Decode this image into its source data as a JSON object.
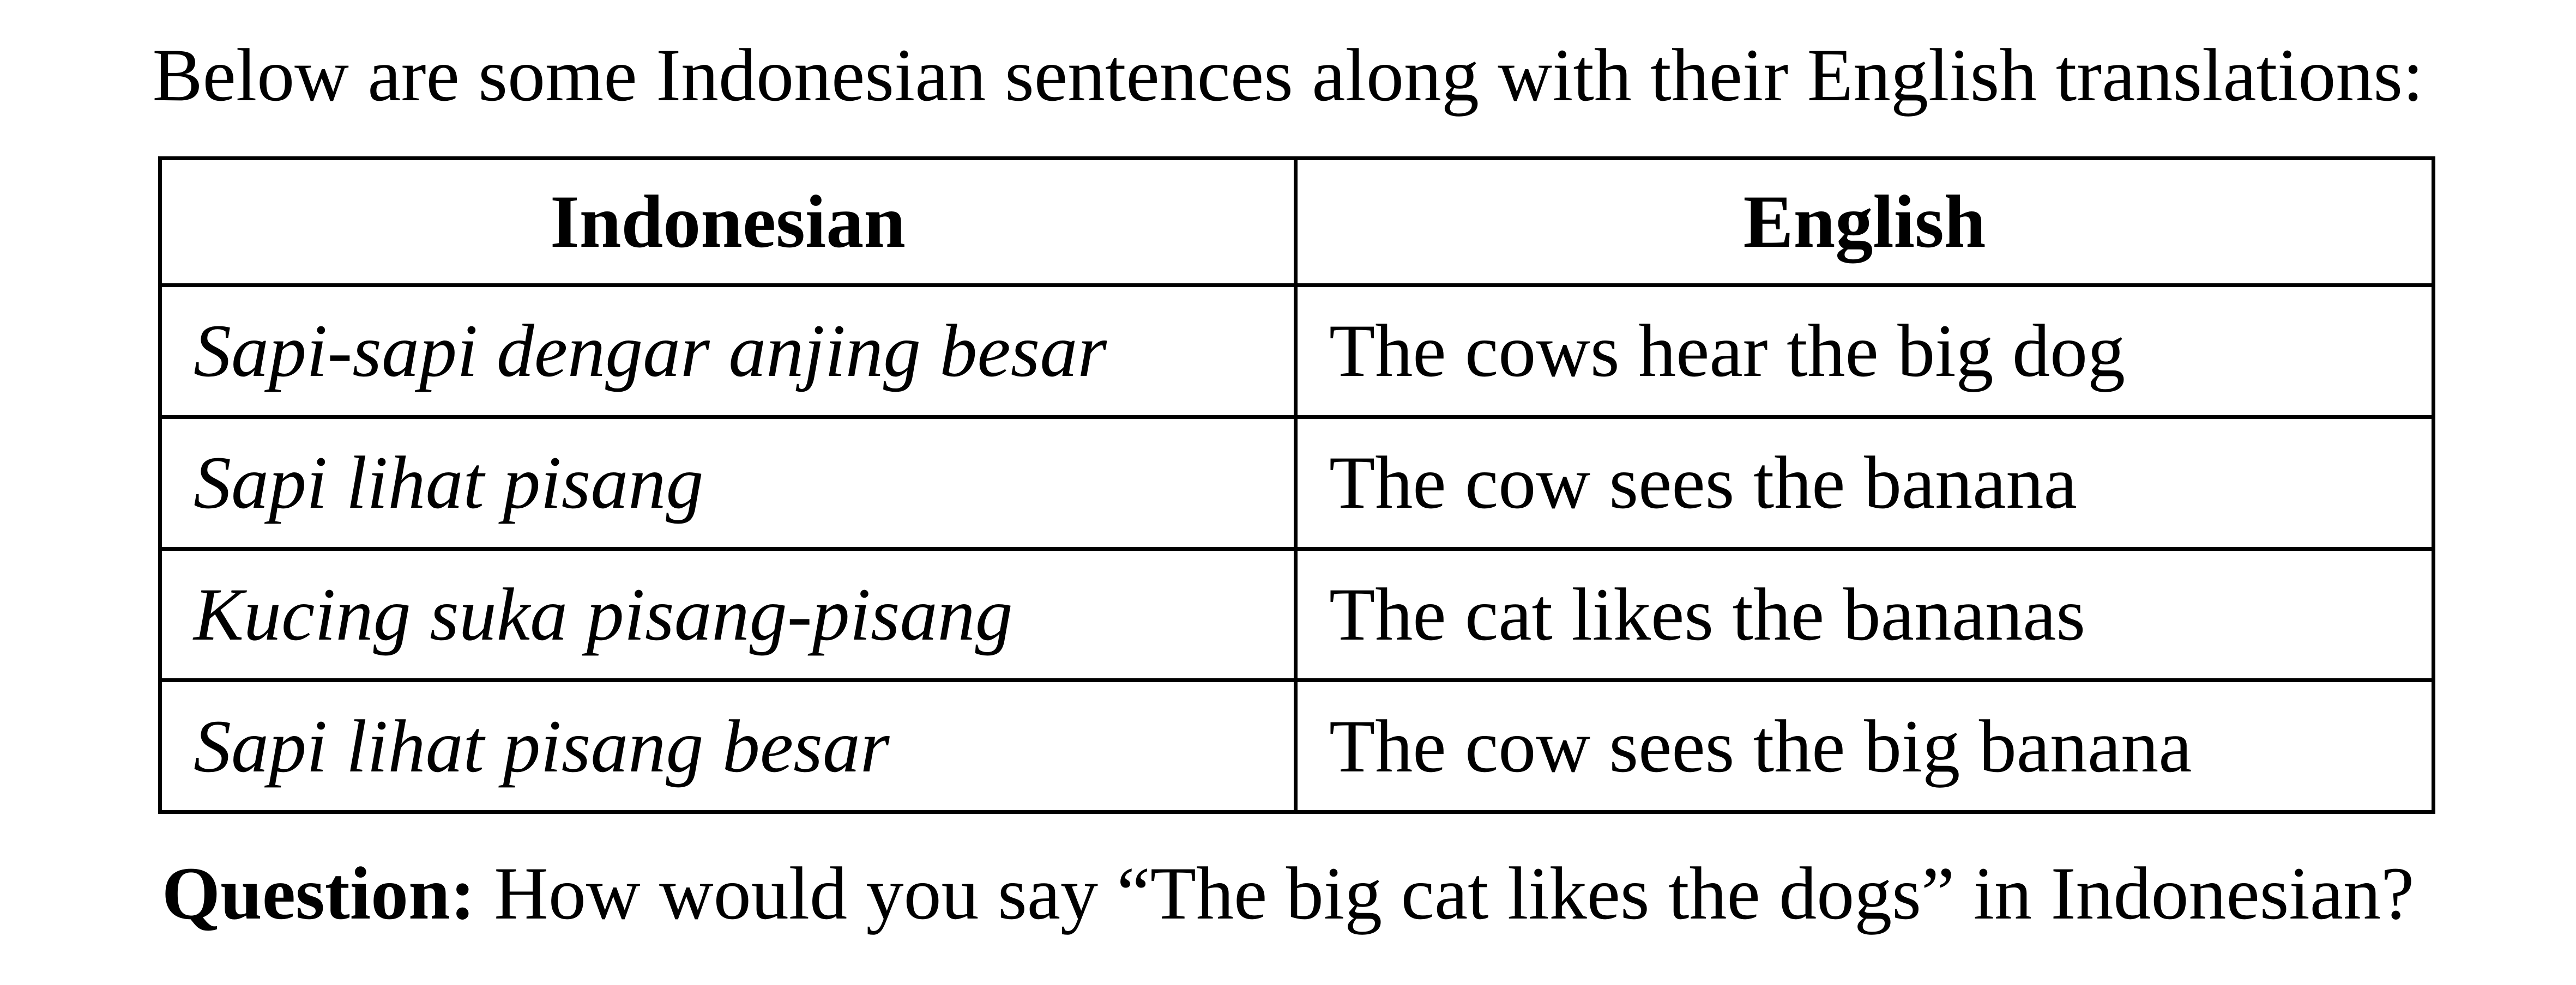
{
  "intro": "Below are some Indonesian sentences along with their English translations:",
  "table": {
    "headers": [
      "Indonesian",
      "English"
    ],
    "rows": [
      {
        "indonesian": "Sapi-sapi dengar anjing besar",
        "english": "The cows hear the big dog"
      },
      {
        "indonesian": "Sapi lihat pisang",
        "english": "The cow sees the banana"
      },
      {
        "indonesian": "Kucing suka pisang-pisang",
        "english": "The cat likes the bananas"
      },
      {
        "indonesian": "Sapi lihat pisang besar",
        "english": "The cow sees the big banana"
      }
    ]
  },
  "question": {
    "label": "Question:",
    "text": " How would you say “The big cat likes the dogs” in Indonesian?"
  }
}
